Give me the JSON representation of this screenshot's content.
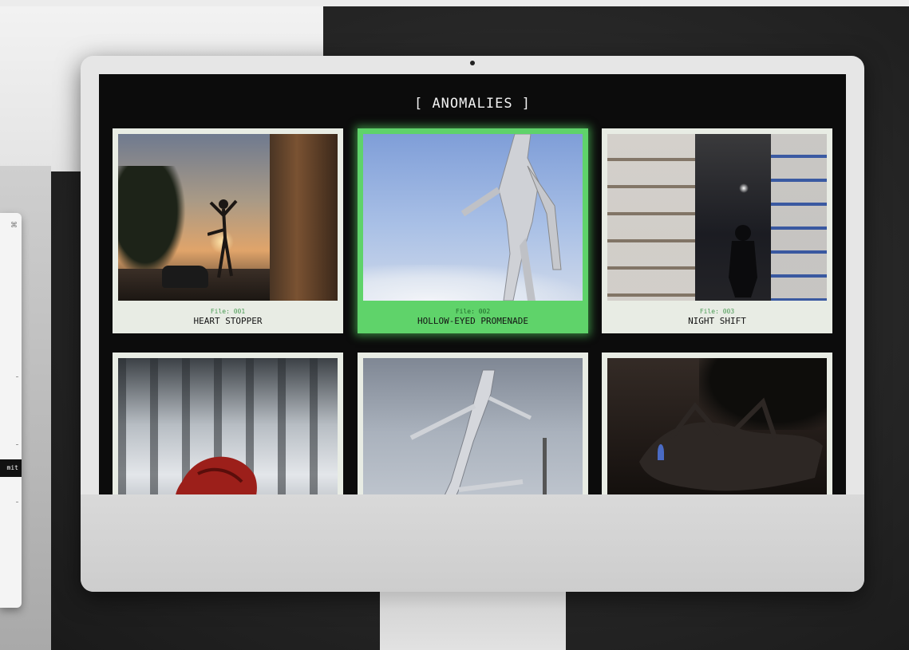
{
  "window": {
    "camera": "camera-dot"
  },
  "side_card": {
    "icon": "⌘",
    "bar_text": "mit"
  },
  "site": {
    "title": "[ ANOMALIES ]",
    "accent_color": "#5fd36a"
  },
  "gallery": {
    "cards": [
      {
        "file": "File: 001",
        "title": "HEART STOPPER",
        "selected": false
      },
      {
        "file": "File: 002",
        "title": "HOLLOW-EYED PROMENADE",
        "selected": true
      },
      {
        "file": "File: 003",
        "title": "NIGHT SHIFT",
        "selected": false
      },
      {
        "file": "",
        "title": "",
        "selected": false
      },
      {
        "file": "",
        "title": "",
        "selected": false
      },
      {
        "file": "",
        "title": "",
        "selected": false
      }
    ]
  }
}
